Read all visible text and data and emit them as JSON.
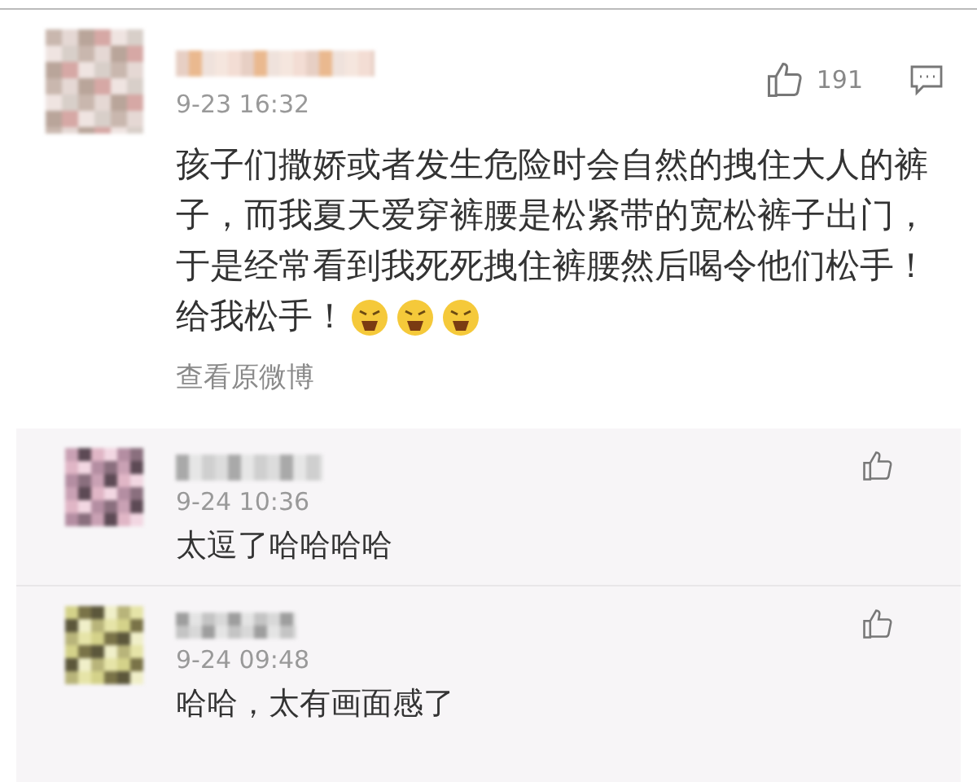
{
  "comment": {
    "time": "9-23 16:32",
    "likes": "191",
    "text": "孩子们撒娇或者发生危险时会自然的拽住大人的裤子，而我夏天爱穿裤腰是松紧带的宽松裤子出门，于是经常看到我死死拽住裤腰然后喝令他们松手！",
    "text_end": "给我松手！",
    "emojis": [
      {
        "kind": "angry"
      },
      {
        "kind": "angry"
      },
      {
        "kind": "angry"
      }
    ],
    "link": "查看原微博"
  },
  "replies": [
    {
      "time": "9-24 10:36",
      "text": "太逗了哈哈哈哈"
    },
    {
      "time": "9-24 09:48",
      "text": "哈哈，太有画面感了"
    }
  ]
}
